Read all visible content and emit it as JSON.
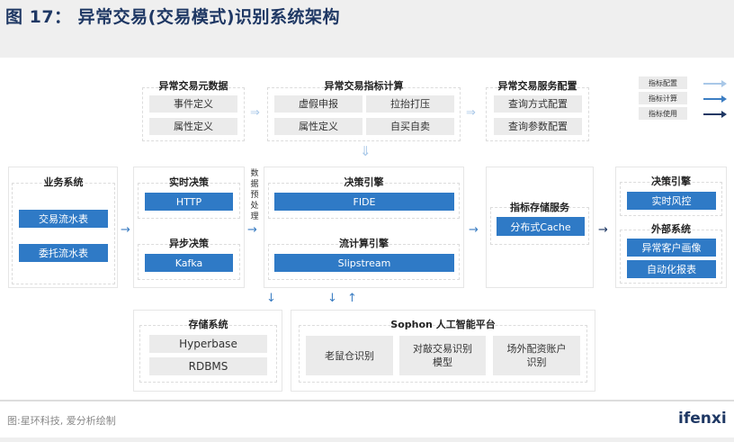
{
  "title": "图 17： 异常交易(交易模式)识别系统架构",
  "top": {
    "meta": {
      "title": "异常交易元数据",
      "items": [
        "事件定义",
        "属性定义"
      ]
    },
    "calc": {
      "title": "异常交易指标计算",
      "items": [
        "虚假申报",
        "拉抬打压",
        "属性定义",
        "自买自卖"
      ]
    },
    "service": {
      "title": "异常交易服务配置",
      "items": [
        "查询方式配置",
        "查询参数配置"
      ]
    }
  },
  "legend": [
    {
      "label": "指标配置",
      "color": "#a9c8e8"
    },
    {
      "label": "指标计算",
      "color": "#3c7ec3"
    },
    {
      "label": "指标使用",
      "color": "#1f3864"
    }
  ],
  "middle": {
    "business": {
      "title": "业务系统",
      "items": [
        "交易流水表",
        "委托流水表"
      ]
    },
    "decision": {
      "realtime": "实时决策",
      "http": "HTTP",
      "async": "异步决策",
      "kafka": "Kafka"
    },
    "preprocess": "数据预处理",
    "engine": {
      "decision": "决策引擎",
      "fide": "FIDE",
      "stream": "流计算引擎",
      "slipstream": "Slipstream"
    },
    "storage": {
      "title": "指标存储服务",
      "cache": "分布式Cache"
    },
    "output": {
      "decision": "决策引擎",
      "risk": "实时风控",
      "external": "外部系统",
      "items": [
        "异常客户画像",
        "自动化报表"
      ]
    }
  },
  "bottom": {
    "store": {
      "title": "存储系统",
      "items": [
        "Hyperbase",
        "RDBMS"
      ]
    },
    "sophon": {
      "title": "Sophon 人工智能平台",
      "items": [
        "老鼠仓识别",
        "对敲交易识别模型",
        "场外配资账户识别"
      ]
    }
  },
  "footer": {
    "source": "图:星环科技, 爱分析绘制",
    "logo": "ifenxi"
  }
}
